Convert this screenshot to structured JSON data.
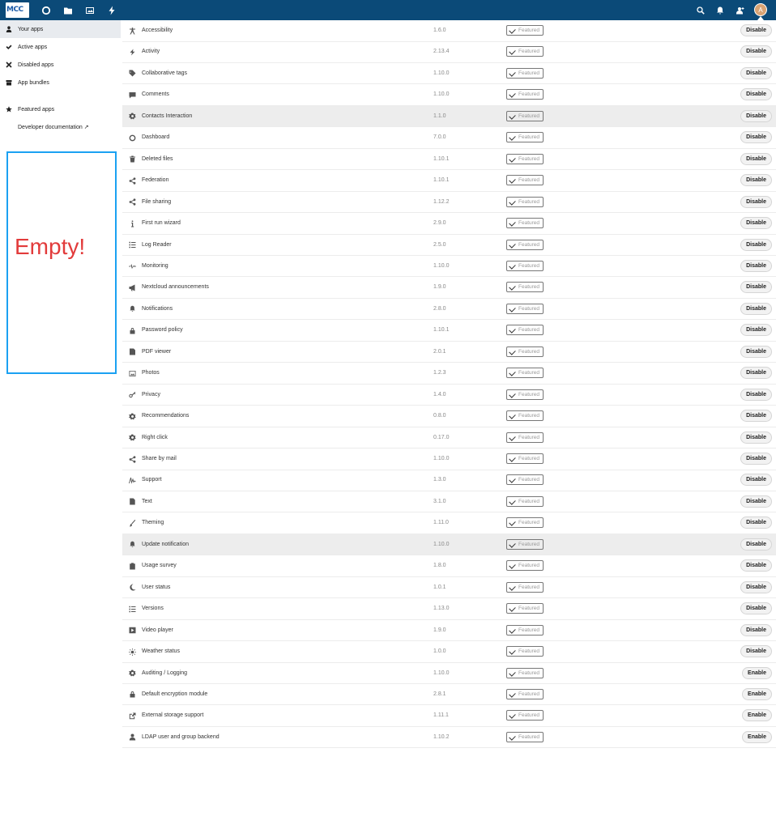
{
  "header": {
    "logo_text": "MCC",
    "avatar_letter": "A",
    "nav_icons": [
      "dashboard-icon",
      "files-icon",
      "photos-icon",
      "activity-icon"
    ],
    "right_icons": [
      "search-icon",
      "notifications-icon",
      "contacts-icon"
    ]
  },
  "sidebar": {
    "items": [
      {
        "label": "Your apps",
        "icon": "user-icon",
        "active": true
      },
      {
        "label": "Active apps",
        "icon": "check-icon"
      },
      {
        "label": "Disabled apps",
        "icon": "close-icon"
      },
      {
        "label": "App bundles",
        "icon": "bundle-icon"
      },
      {
        "label": "Featured apps",
        "icon": "star-icon"
      },
      {
        "label": "Developer documentation ↗",
        "icon": ""
      }
    ],
    "empty_text": "Empty!"
  },
  "featured_label": "Featured",
  "apps": [
    {
      "name": "Accessibility",
      "version": "1.6.0",
      "action": "Disable",
      "icon": "accessibility-icon"
    },
    {
      "name": "Activity",
      "version": "2.13.4",
      "action": "Disable",
      "icon": "bolt-icon"
    },
    {
      "name": "Collaborative tags",
      "version": "1.10.0",
      "action": "Disable",
      "icon": "tag-icon"
    },
    {
      "name": "Comments",
      "version": "1.10.0",
      "action": "Disable",
      "icon": "comment-icon"
    },
    {
      "name": "Contacts Interaction",
      "version": "1.1.0",
      "action": "Disable",
      "icon": "gear-icon",
      "highlight": true
    },
    {
      "name": "Dashboard",
      "version": "7.0.0",
      "action": "Disable",
      "icon": "circle-icon"
    },
    {
      "name": "Deleted files",
      "version": "1.10.1",
      "action": "Disable",
      "icon": "trash-icon"
    },
    {
      "name": "Federation",
      "version": "1.10.1",
      "action": "Disable",
      "icon": "share-icon"
    },
    {
      "name": "File sharing",
      "version": "1.12.2",
      "action": "Disable",
      "icon": "share-icon"
    },
    {
      "name": "First run wizard",
      "version": "2.9.0",
      "action": "Disable",
      "icon": "info-icon"
    },
    {
      "name": "Log Reader",
      "version": "2.5.0",
      "action": "Disable",
      "icon": "list-icon"
    },
    {
      "name": "Monitoring",
      "version": "1.10.0",
      "action": "Disable",
      "icon": "pulse-icon"
    },
    {
      "name": "Nextcloud announcements",
      "version": "1.9.0",
      "action": "Disable",
      "icon": "megaphone-icon"
    },
    {
      "name": "Notifications",
      "version": "2.8.0",
      "action": "Disable",
      "icon": "bell-icon"
    },
    {
      "name": "Password policy",
      "version": "1.10.1",
      "action": "Disable",
      "icon": "lock-icon"
    },
    {
      "name": "PDF viewer",
      "version": "2.0.1",
      "action": "Disable",
      "icon": "pdf-icon"
    },
    {
      "name": "Photos",
      "version": "1.2.3",
      "action": "Disable",
      "icon": "image-icon"
    },
    {
      "name": "Privacy",
      "version": "1.4.0",
      "action": "Disable",
      "icon": "key-icon"
    },
    {
      "name": "Recommendations",
      "version": "0.8.0",
      "action": "Disable",
      "icon": "gear-icon"
    },
    {
      "name": "Right click",
      "version": "0.17.0",
      "action": "Disable",
      "icon": "gear-icon"
    },
    {
      "name": "Share by mail",
      "version": "1.10.0",
      "action": "Disable",
      "icon": "share-icon"
    },
    {
      "name": "Support",
      "version": "1.3.0",
      "action": "Disable",
      "icon": "signature-icon"
    },
    {
      "name": "Text",
      "version": "3.1.0",
      "action": "Disable",
      "icon": "document-icon"
    },
    {
      "name": "Theming",
      "version": "1.11.0",
      "action": "Disable",
      "icon": "brush-icon"
    },
    {
      "name": "Update notification",
      "version": "1.10.0",
      "action": "Disable",
      "icon": "bell-icon",
      "highlight": true
    },
    {
      "name": "Usage survey",
      "version": "1.8.0",
      "action": "Disable",
      "icon": "clipboard-icon"
    },
    {
      "name": "User status",
      "version": "1.0.1",
      "action": "Disable",
      "icon": "moon-icon"
    },
    {
      "name": "Versions",
      "version": "1.13.0",
      "action": "Disable",
      "icon": "list-icon"
    },
    {
      "name": "Video player",
      "version": "1.9.0",
      "action": "Disable",
      "icon": "play-icon"
    },
    {
      "name": "Weather status",
      "version": "1.0.0",
      "action": "Disable",
      "icon": "sun-icon"
    },
    {
      "name": "Auditing / Logging",
      "version": "1.10.0",
      "action": "Enable",
      "icon": "gear-icon"
    },
    {
      "name": "Default encryption module",
      "version": "2.8.1",
      "action": "Enable",
      "icon": "lock-icon"
    },
    {
      "name": "External storage support",
      "version": "1.11.1",
      "action": "Enable",
      "icon": "external-icon"
    },
    {
      "name": "LDAP user and group backend",
      "version": "1.10.2",
      "action": "Enable",
      "icon": "user-icon"
    }
  ]
}
